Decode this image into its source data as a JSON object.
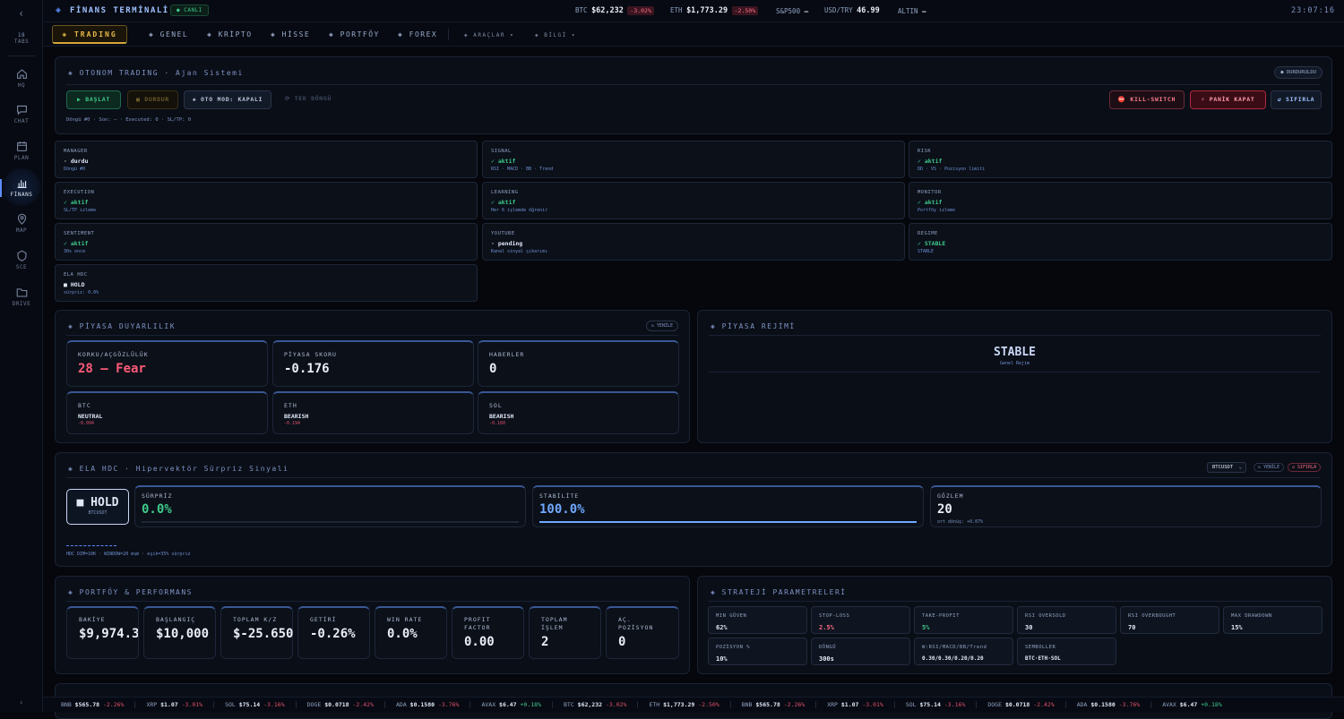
{
  "sidebar": {
    "back": "‹",
    "tabs_count": "18",
    "tabs_label": "TABS",
    "items": [
      {
        "label": "HQ",
        "icon": "home-icon"
      },
      {
        "label": "CHAT",
        "icon": "chat-icon"
      },
      {
        "label": "PLAN",
        "icon": "calendar-icon"
      },
      {
        "label": "FİNANS",
        "icon": "bar-chart-icon"
      },
      {
        "label": "MAP",
        "icon": "map-pin-icon"
      },
      {
        "label": "SCE",
        "icon": "shield-icon"
      },
      {
        "label": "DRIVE",
        "icon": "folder-icon"
      }
    ],
    "bottom": "‹"
  },
  "topbar": {
    "logo": "◈",
    "title": "FİNANS TERMİNALİ",
    "live": "● CANLI",
    "quotes": [
      {
        "sym": "BTC",
        "price": "$62,232",
        "chg": "-3.02%"
      },
      {
        "sym": "ETH",
        "price": "$1,773.29",
        "chg": "-2.50%"
      },
      {
        "sym": "S&P500",
        "price": "—",
        "chg": ""
      },
      {
        "sym": "USD/TRY",
        "price": "46.99",
        "chg": ""
      },
      {
        "sym": "ALTIN",
        "price": "—",
        "chg": ""
      }
    ],
    "clock": "23:07:16"
  },
  "nav": {
    "active": "◈ TRADING",
    "tabs": [
      "◈ GENEL",
      "◈ KRİPTO",
      "◈ HİSSE",
      "◈ PORTFÖY",
      "◈ FOREX"
    ],
    "dropdowns": [
      "◈ ARAÇLAR ▾",
      "◈ BİLGİ ▾"
    ]
  },
  "autonomous": {
    "title": "◈ OTONOM TRADING · Ajan Sistemi",
    "status": "● DURDURULDU",
    "btn_start": "▶ BAŞLAT",
    "btn_stop": "■ DURDUR",
    "btn_auto": "◈ OTO MOD: KAPALI",
    "btn_cycle": "⟳ TEK DÖNGÜ",
    "btn_kill": "⛔ KILL-SWITCH",
    "btn_panic": "⚡ PANİK KAPAT",
    "btn_reset": "↺ SIFIRLA",
    "info": "Döngü #0 · Son: — · Executed: 0 · SL/TP: 0"
  },
  "agents": [
    {
      "name": "MANAGER",
      "status": "· durdu",
      "desc": "Döngü #0",
      "color": "#dfe7f7"
    },
    {
      "name": "SIGNAL",
      "status": "✓ aktif",
      "desc": "RSI · MACD · BB · Trend",
      "color": "#3fc98a"
    },
    {
      "name": "RISK",
      "status": "✓ aktif",
      "desc": "DD · VS · Pozisyon limiti",
      "color": "#3fc98a"
    },
    {
      "name": "EXECUTION",
      "status": "✓ aktif",
      "desc": "SL/TP izleme",
      "color": "#3fc98a"
    },
    {
      "name": "LEARNING",
      "status": "✓ aktif",
      "desc": "Her 6 işlemde öğrenir",
      "color": "#3fc98a"
    },
    {
      "name": "MONITOR",
      "status": "✓ aktif",
      "desc": "Portföy izleme",
      "color": "#3fc98a"
    },
    {
      "name": "SENTIMENT",
      "status": "✓ aktif",
      "desc": "30s once",
      "color": "#3fc98a"
    },
    {
      "name": "YOUTUBE",
      "status": "· pending",
      "desc": "Kanal sinyal çıkarımı",
      "color": "#dfe7f7"
    },
    {
      "name": "REGIME",
      "status": "✓ STABLE",
      "desc": "STABLE",
      "color": "#3fc98a"
    },
    {
      "name": "ELA HDC",
      "status": "■ HOLD",
      "desc": "sürpriz: 0.0%",
      "color": "#dfe7f7"
    }
  ],
  "sentiment": {
    "title": "◈ PİYASA DUYARLILIK",
    "refresh": "↻ YENİLE",
    "cards": [
      {
        "label": "KORKU/AÇGÖZLÜLÜK",
        "value": "28 — Fear"
      },
      {
        "label": "PİYASA SKORU",
        "value": "-0.176"
      },
      {
        "label": "HABERLER",
        "value": "0"
      }
    ],
    "coins": [
      {
        "label": "BTC",
        "state": "NEUTRAL",
        "score": "-0.094"
      },
      {
        "label": "ETH",
        "state": "BEARISH",
        "score": "-0.194"
      },
      {
        "label": "SOL",
        "state": "BEARISH",
        "score": "-0.160"
      }
    ]
  },
  "regime": {
    "title": "◈ PİYASA REJİMİ",
    "value": "STABLE",
    "sub": "Genel Rejim"
  },
  "ela": {
    "title": "◈ ELA HDC · Hipervektör Sürpriz Sinyali",
    "symbol": "BTCUSDT",
    "refresh": "↻ YENİLE",
    "reset": "↺ SIFIRLA",
    "signal": "■ HOLD",
    "signal_sym": "BTCUSDT",
    "surprise_label": "SÜRPRİZ",
    "surprise": "0.0%",
    "stability_label": "STABİLİTE",
    "stability": "100.0%",
    "stability_fill": 1.0,
    "obs_label": "GÖZLEM",
    "obs": "20",
    "obs_sub": "ort dönüş: +0.07%",
    "footer": "HDC DIM=10K · WINDOW=20 mum · eşik=35% sürpriz"
  },
  "portfolio": {
    "title": "◈ PORTFÖY & PERFORMANS",
    "cards": [
      {
        "label": "BAKİYE",
        "value": "$9,974.3"
      },
      {
        "label": "BAŞLANGIÇ",
        "value": "$10,000"
      },
      {
        "label": "TOPLAM K/Z",
        "value": "$-25.650"
      },
      {
        "label": "GETİRİ",
        "value": "-0.26%"
      },
      {
        "label": "WIN RATE",
        "value": "0.0%"
      },
      {
        "label": "PROFIT FACTOR",
        "value": "0.00"
      },
      {
        "label": "TOPLAM İŞLEM",
        "value": "2"
      },
      {
        "label": "AÇ. POZİSYON",
        "value": "0"
      }
    ]
  },
  "strategy": {
    "title": "◈ STRATEJİ PARAMETRELERİ",
    "params": [
      {
        "label": "MIN GÜVEN",
        "value": "62%",
        "color": "#dfe7f7"
      },
      {
        "label": "STOP-LOSS",
        "value": "2.5%",
        "color": "#e0506a"
      },
      {
        "label": "TAKE-PROFIT",
        "value": "5%",
        "color": "#3fc98a"
      },
      {
        "label": "RSI OVERSOLD",
        "value": "30",
        "color": "#dfe7f7"
      },
      {
        "label": "RSI OVERBOUGHT",
        "value": "70",
        "color": "#dfe7f7"
      },
      {
        "label": "MAX DRAWDOWN",
        "value": "15%",
        "color": "#dfe7f7"
      },
      {
        "label": "POZİSYON %",
        "value": "10%",
        "color": "#dfe7f7"
      },
      {
        "label": "DÖNGÜ",
        "value": "300s",
        "color": "#dfe7f7"
      },
      {
        "label": "W:RSI/MACD/BB/Trend",
        "value": "0.30/0.30/0.20/0.20",
        "color": "#dfe7f7"
      },
      {
        "label": "SEMBOLLER",
        "value": "BTC·ETH·SOL",
        "color": "#dfe7f7"
      }
    ]
  },
  "ticker": [
    {
      "sym": "BNB",
      "price": "$565.78",
      "chg": "-2.26%"
    },
    {
      "sym": "XRP",
      "price": "$1.07",
      "chg": "-3.01%"
    },
    {
      "sym": "SOL",
      "price": "$75.14",
      "chg": "-3.16%"
    },
    {
      "sym": "DOGE",
      "price": "$0.0718",
      "chg": "-2.42%"
    },
    {
      "sym": "ADA",
      "price": "$0.1580",
      "chg": "-3.76%"
    },
    {
      "sym": "AVAX",
      "price": "$6.47",
      "chg": "+0.18%"
    },
    {
      "sym": "BTC",
      "price": "$62,232",
      "chg": "-3.02%"
    },
    {
      "sym": "ETH",
      "price": "$1,773.29",
      "chg": "-2.50%"
    },
    {
      "sym": "BNB",
      "price": "$565.78",
      "chg": "-2.26%"
    },
    {
      "sym": "XRP",
      "price": "$1.07",
      "chg": "-3.01%"
    },
    {
      "sym": "SOL",
      "price": "$75.14",
      "chg": "-3.16%"
    },
    {
      "sym": "DOGE",
      "price": "$0.0718",
      "chg": "-2.42%"
    },
    {
      "sym": "ADA",
      "price": "$0.1580",
      "chg": "-3.76%"
    },
    {
      "sym": "AVAX",
      "price": "$6.47",
      "chg": "+0.18%"
    }
  ]
}
